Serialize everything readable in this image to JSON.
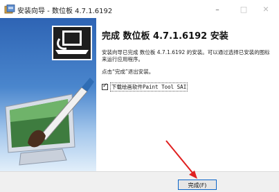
{
  "window": {
    "title": "安装向导 - 数位板 4.7.1.6192",
    "controls": {
      "minimize": "–",
      "maximize": "□",
      "close": "✕"
    }
  },
  "content": {
    "heading": "完成 数位板 4.7.1.6192 安装",
    "paragraph1": "安装向导已完成 数位板 4.7.1.6192 的安装。可以通过选择已安装的图标来运行应用程序。",
    "paragraph2": "点击“完成”退出安装。",
    "checkbox": {
      "label": "下载绘画软件Paint Tool SAI",
      "checked": true
    }
  },
  "footer": {
    "finish_label": "完成(F)"
  },
  "colors": {
    "accent": "#0a64c8",
    "arrow": "#e02020"
  }
}
